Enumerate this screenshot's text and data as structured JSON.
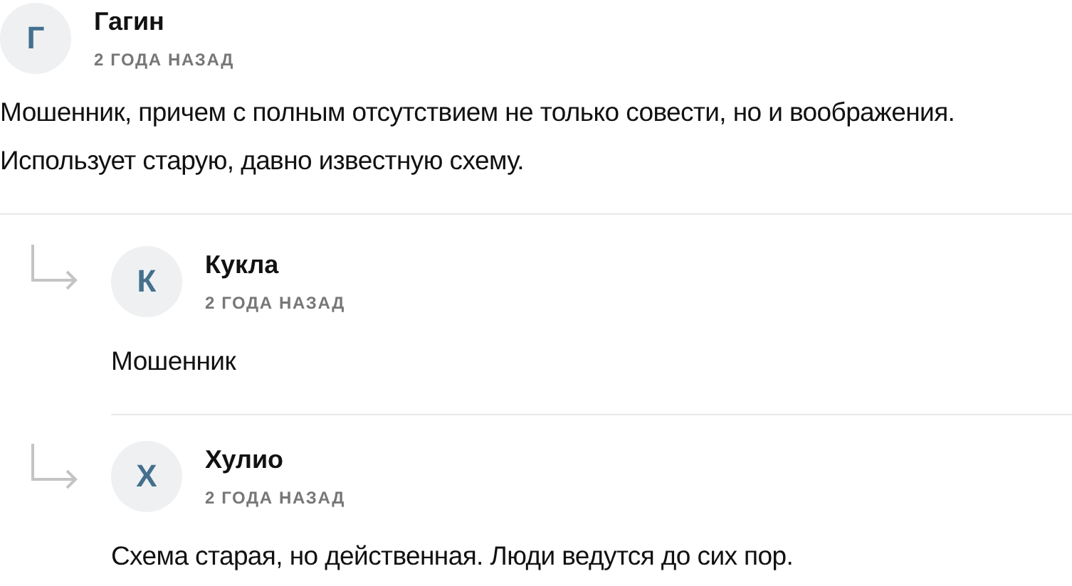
{
  "comments": [
    {
      "initial": "Г",
      "author": "Гагин",
      "time": "2 ГОДА НАЗАД",
      "text": "Мошенник, причем с полным отсутствием не только совести, но и воображения. Использует старую, давно известную схему.",
      "replies": [
        {
          "initial": "К",
          "author": "Кукла",
          "time": "2 ГОДА НАЗАД",
          "text": "Мошенник"
        },
        {
          "initial": "Х",
          "author": "Хулио",
          "time": "2 ГОДА НАЗАД",
          "text": "Схема старая, но действенная. Люди ведутся до сих пор."
        }
      ]
    }
  ]
}
